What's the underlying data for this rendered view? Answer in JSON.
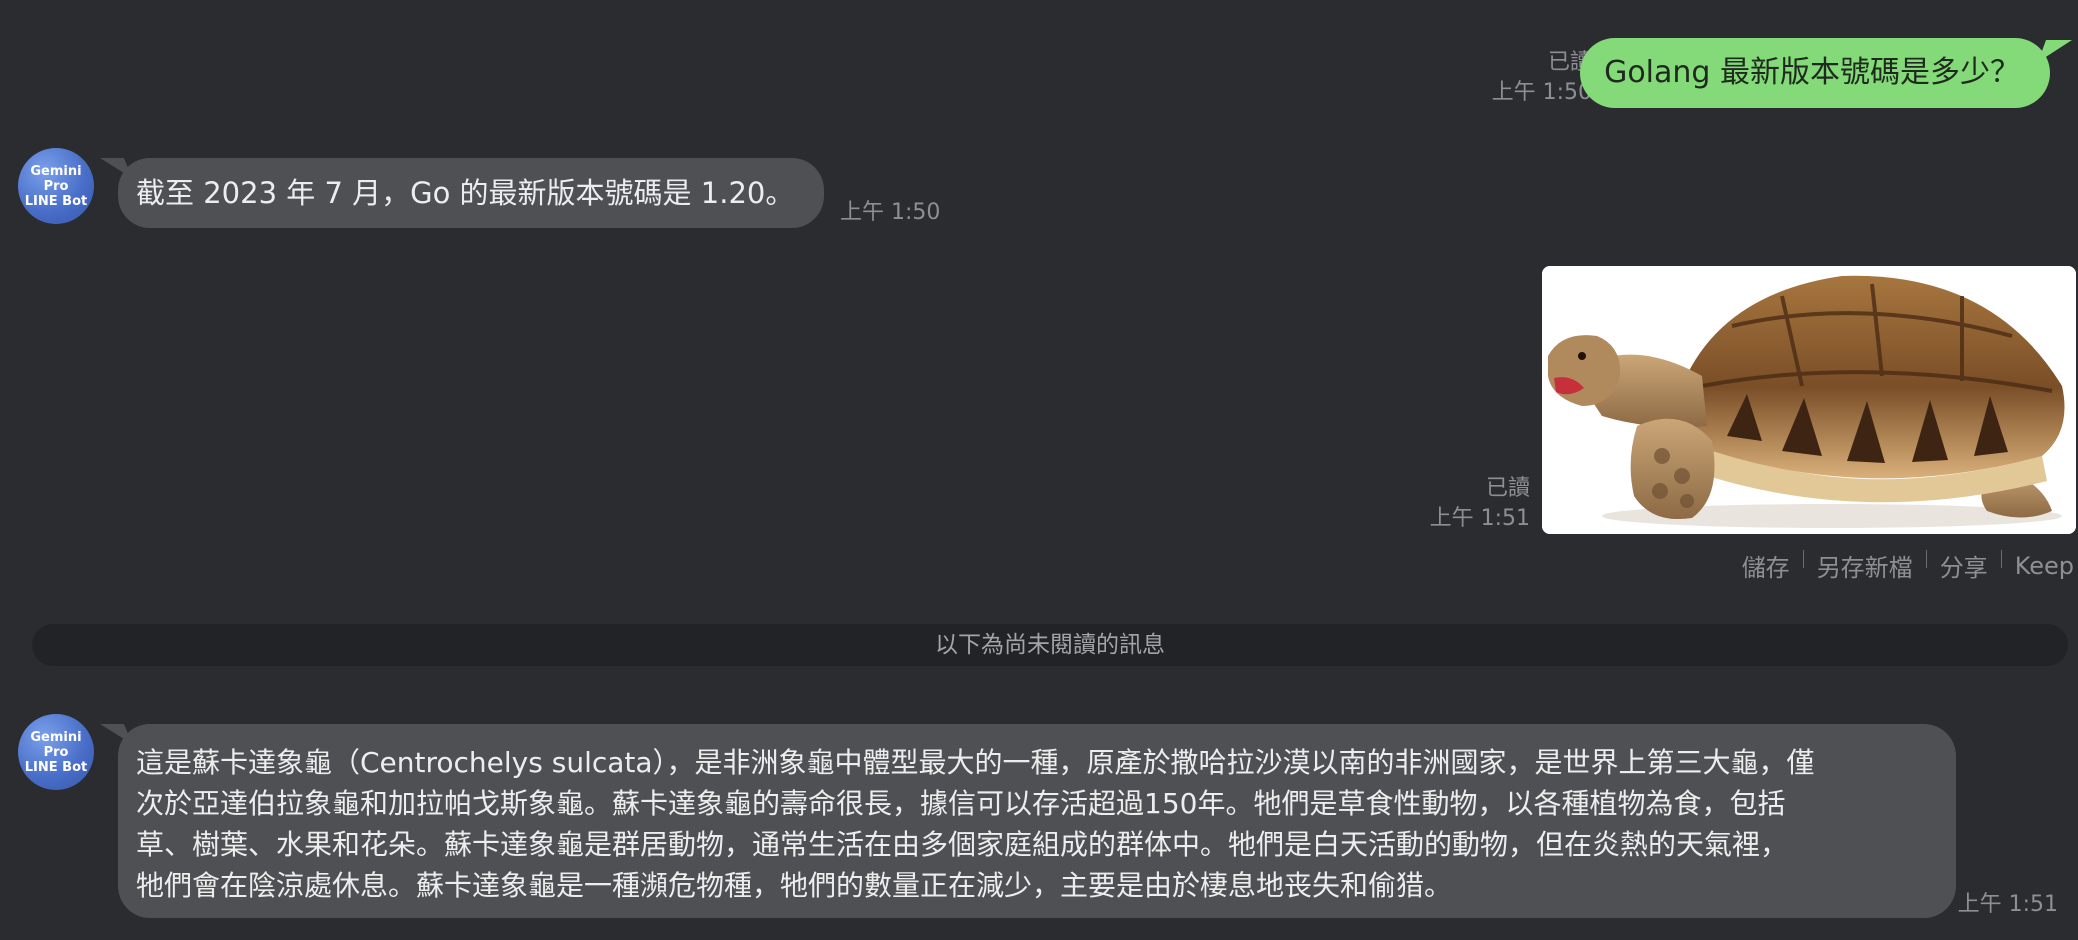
{
  "messages": [
    {
      "direction": "out",
      "text": "Golang 最新版本號碼是多少？",
      "read_label": "已讀",
      "time": "上午 1:50"
    },
    {
      "direction": "in",
      "sender": {
        "line1": "Gemini Pro",
        "line2": "LINE Bot"
      },
      "text": "截至 2023 年 7 月，Go 的最新版本號碼是 1.20。",
      "time": "上午 1:50"
    },
    {
      "direction": "out",
      "type": "image",
      "image_icon": "sulcata-tortoise-photo",
      "read_label": "已讀",
      "time": "上午 1:51",
      "actions": [
        "儲存",
        "另存新檔",
        "分享",
        "Keep"
      ]
    },
    {
      "direction": "in",
      "sender": {
        "line1": "Gemini Pro",
        "line2": "LINE Bot"
      },
      "lines": [
        " 這是蘇卡達象龜（Centrochelys sulcata），是非洲象龜中體型最大的一種，原產於撒哈拉沙漠以南的非洲國家，是世界上第三大龜，僅",
        "次於亞達伯拉象龜和加拉帕戈斯象龜。蘇卡達象龜的壽命很長，據信可以存活超過150年。牠們是草食性動物，以各種植物為食，包括",
        "草、樹葉、水果和花朵。蘇卡達象龜是群居動物，通常生活在由多個家庭組成的群体中。牠們是白天活動的動物，但在炎熱的天氣裡，",
        "牠們會在陰涼處休息。蘇卡達象龜是一種瀕危物種，牠們的數量正在減少，主要是由於棲息地丧失和偷猎。"
      ],
      "time": "上午 1:51"
    }
  ],
  "unread_divider": "以下為尚未閱讀的訊息",
  "colors": {
    "background": "#2b2c2f",
    "outgoing_bubble": "#84da78",
    "incoming_bubble": "#4f5054",
    "avatar": "#4a6fc9",
    "meta_text": "#8d8f94"
  }
}
